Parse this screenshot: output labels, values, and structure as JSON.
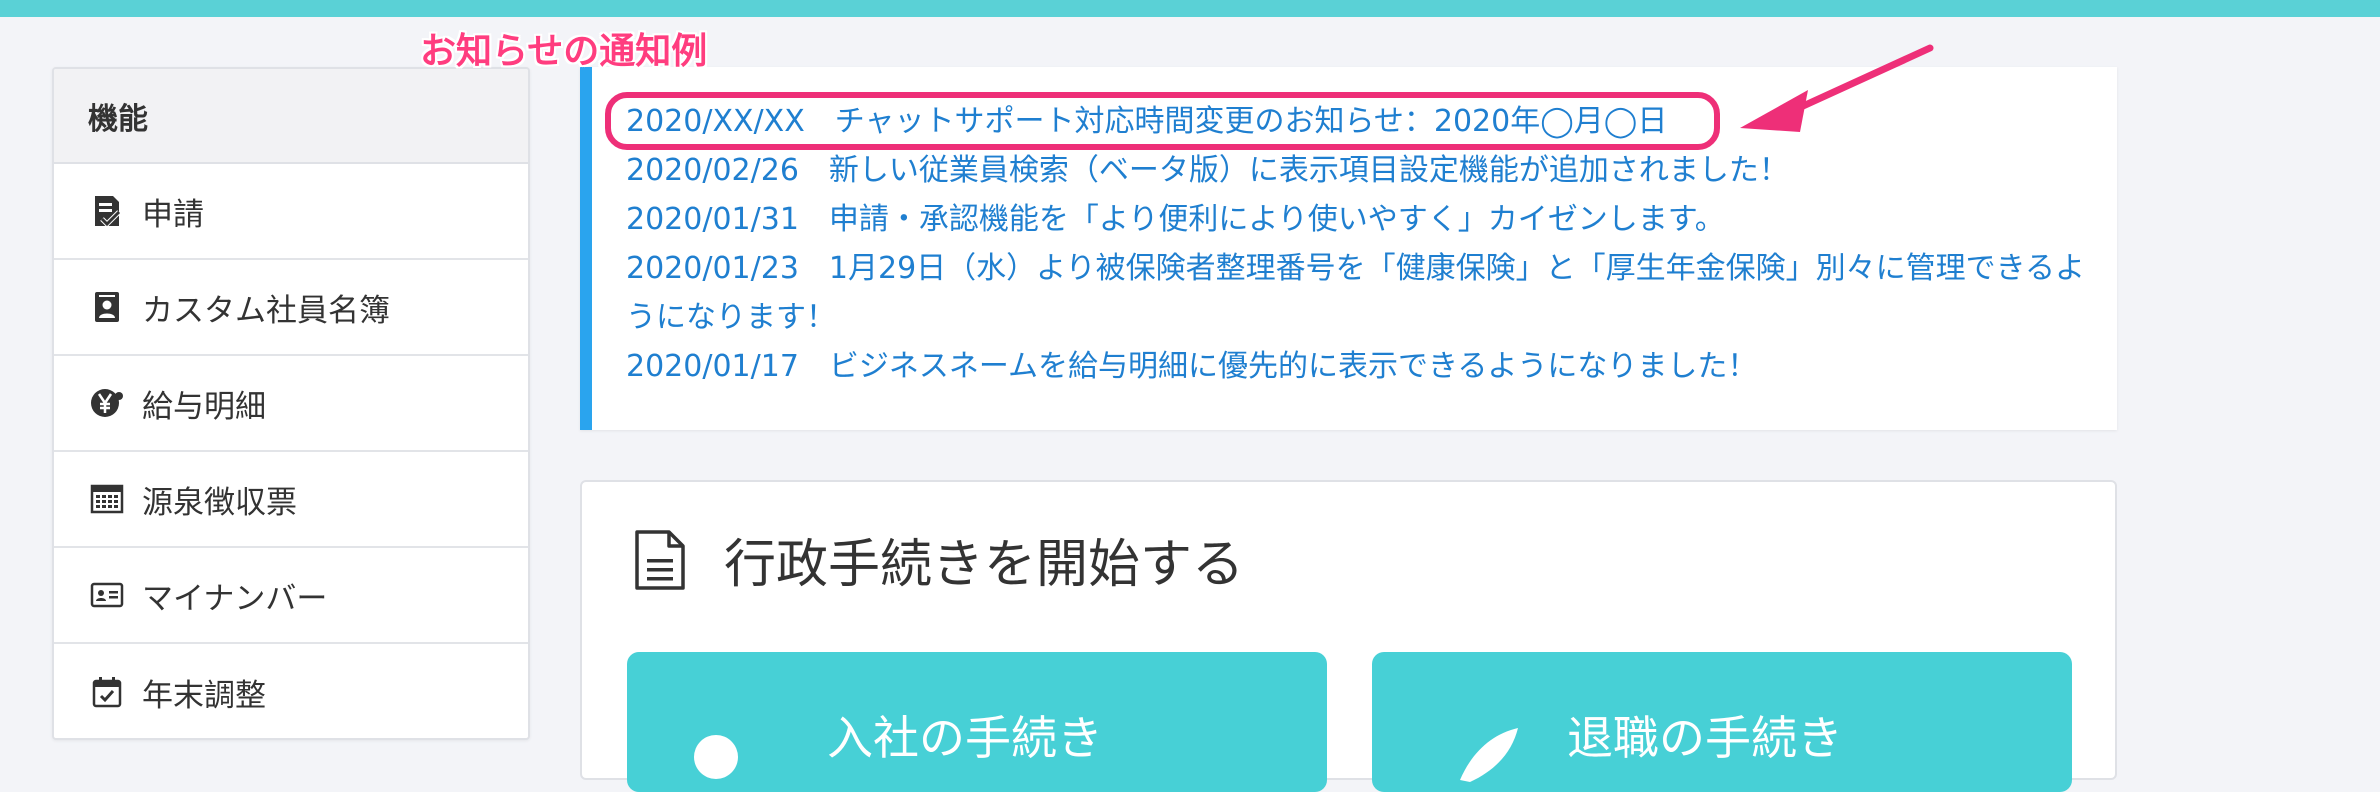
{
  "annotation": {
    "label": "お知らせの通知例",
    "color": "#ee2f78"
  },
  "sidebar": {
    "header": "機能",
    "items": [
      {
        "label": "申請",
        "icon": "checklist-icon"
      },
      {
        "label": "カスタム社員名簿",
        "icon": "id-badge-icon"
      },
      {
        "label": "給与明細",
        "icon": "yen-icon"
      },
      {
        "label": "源泉徴収票",
        "icon": "calculator-icon"
      },
      {
        "label": "マイナンバー",
        "icon": "id-card-icon"
      },
      {
        "label": "年末調整",
        "icon": "calendar-check-icon"
      }
    ]
  },
  "notices": {
    "items": [
      {
        "date": "2020/XX/XX",
        "text": "チャットサポート対応時間変更のお知らせ：2020年◯月◯日"
      },
      {
        "date": "2020/02/26",
        "text": "新しい従業員検索（ベータ版）に表示項目設定機能が追加されました！"
      },
      {
        "date": "2020/01/31",
        "text": "申請・承認機能を「より便利により使いやすく」カイゼンします。"
      },
      {
        "date": "2020/01/23",
        "text": "1月29日（水）より被保険者整理番号を「健康保険」と「厚生年金保険」別々に管理できるようになります！"
      },
      {
        "date": "2020/01/17",
        "text": "ビジネスネームを給与明細に優先的に表示できるようになりました！"
      }
    ],
    "link_color": "#1f7fd0",
    "accent": "#2aa4ee"
  },
  "procedures": {
    "title": "行政手続きを開始する",
    "cards": [
      {
        "label": "入社の手続き",
        "icon": "person-icon"
      },
      {
        "label": "退職の手続き",
        "icon": "rocket-icon"
      }
    ],
    "card_color": "#47d0d6"
  },
  "theme": {
    "topbar": "#5ad1d6",
    "background": "#f3f4f8"
  }
}
